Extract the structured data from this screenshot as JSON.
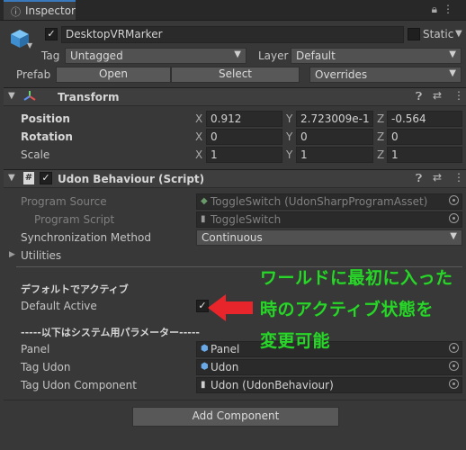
{
  "window": {
    "tab_label": "Inspector",
    "tab_icon": "info-icon"
  },
  "gameobject": {
    "name": "DesktopVRMarker",
    "static_label": "Static",
    "tag_label": "Tag",
    "tag_value": "Untagged",
    "layer_label": "Layer",
    "layer_value": "Default",
    "prefab_label": "Prefab",
    "open_label": "Open",
    "select_label": "Select",
    "overrides_label": "Overrides"
  },
  "transform": {
    "title": "Transform",
    "rows": [
      {
        "label": "Position",
        "x": "0.912",
        "y": "2.723009e-1",
        "z": "-0.564"
      },
      {
        "label": "Rotation",
        "x": "0",
        "y": "0",
        "z": "0"
      },
      {
        "label": "Scale",
        "x": "1",
        "y": "1",
        "z": "1"
      }
    ],
    "axis_x": "X",
    "axis_y": "Y",
    "axis_z": "Z"
  },
  "udon": {
    "title": "Udon Behaviour (Script)",
    "program_source_label": "Program Source",
    "program_source_value": "ToggleSwitch (UdonSharpProgramAsset)",
    "program_script_label": "Program Script",
    "program_script_value": "ToggleSwitch",
    "sync_label": "Synchronization Method",
    "sync_value": "Continuous",
    "utilities_label": "Utilities",
    "section1": "デフォルトでアクティブ",
    "default_active_label": "Default Active",
    "default_active_check": "✓",
    "section2": "-----以下はシステム用パラメーター-----",
    "fields": [
      {
        "label": "Panel",
        "value": "Panel"
      },
      {
        "label": "Tag Udon",
        "value": "Udon"
      },
      {
        "label": "Tag Udon Component",
        "value": "Udon (UdonBehaviour)"
      }
    ]
  },
  "add_component_label": "Add Component",
  "annotation": {
    "lines": [
      "ワールドに最初に入った",
      "時のアクティブ状態を",
      "変更可能"
    ],
    "color": "#2ad42a",
    "arrow_color": "#e8252a"
  }
}
